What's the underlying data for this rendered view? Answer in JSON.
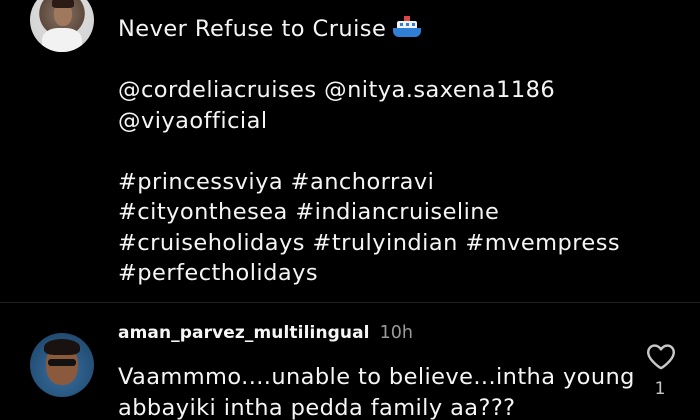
{
  "post": {
    "caption": {
      "title_line": "Never Refuse to Cruise",
      "emoji": "ship-icon",
      "mentions_line_1": "@cordeliacruises @nitya.saxena1186",
      "mentions_line_2": "@viyaofficial",
      "hashtags_line_1": "#princessviya #anchorravi",
      "hashtags_line_2": "#cityonthesea #indiancruiseline",
      "hashtags_line_3": "#cruiseholidays #trulyindian #mvempress",
      "hashtags_line_4": "#perfectholidays"
    }
  },
  "comment": {
    "username": "aman_parvez_multilingual",
    "timestamp": "10h",
    "text_line_1": "Vaammmo....unable to believe...intha young",
    "text_line_2": "abbayiki intha pedda family aa???",
    "like_icon": "heart-outline-icon",
    "like_count": "1"
  },
  "colors": {
    "background": "#000000",
    "text": "#f5f5f5",
    "muted": "#9a9a9a",
    "divider": "#1f1f1f",
    "ship_hull": "#2f7fd6"
  }
}
